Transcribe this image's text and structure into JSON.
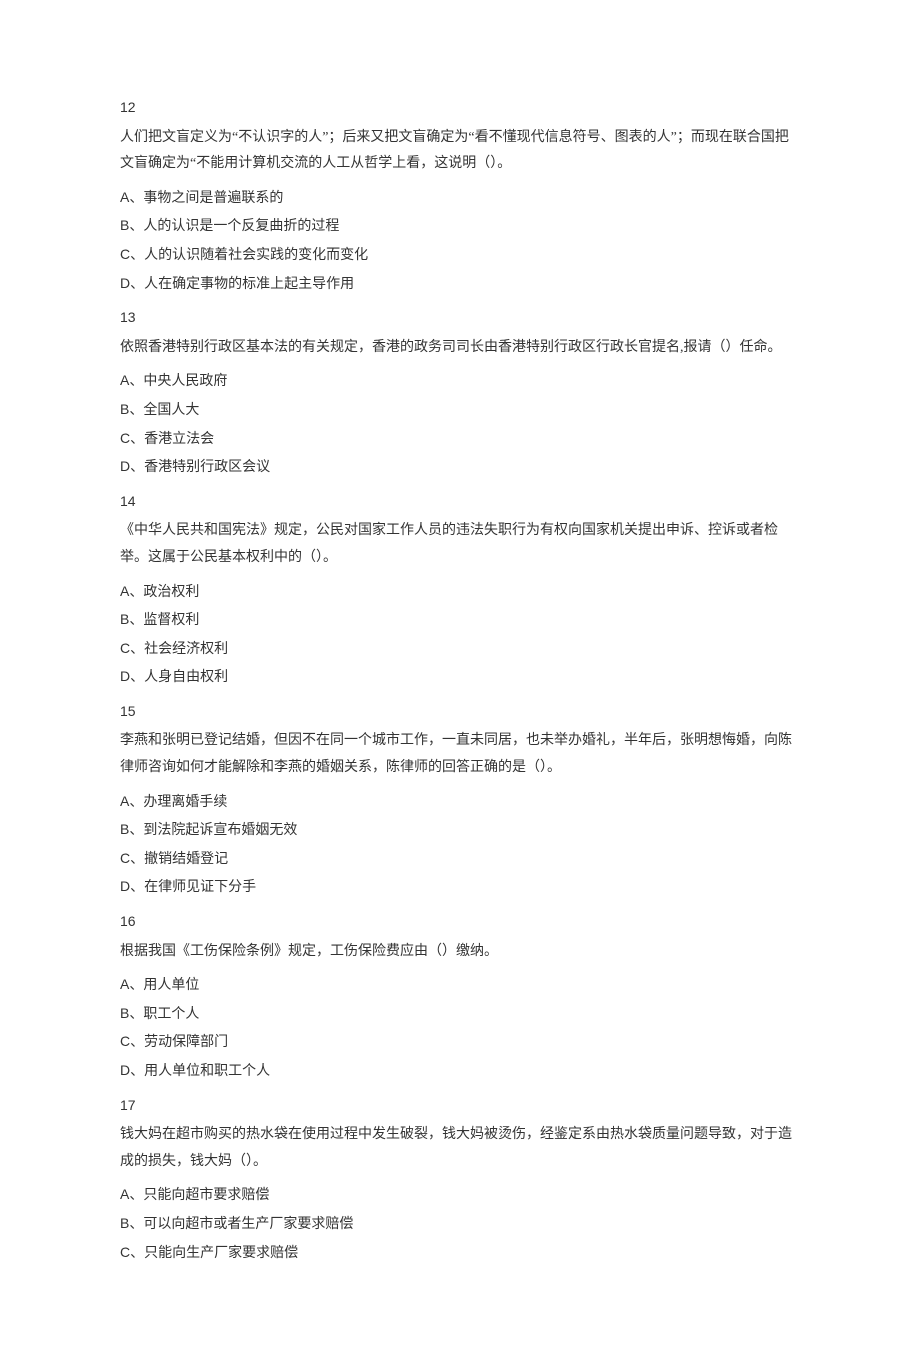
{
  "questions": [
    {
      "num": "12",
      "stem": "人们把文盲定义为“不认识字的人”；后来又把文盲确定为“看不懂现代信息符号、图表的人”；而现在联合国把文盲确定为“不能用计算机交流的人工从哲学上看，这说明（）。",
      "options": [
        {
          "letter": "A、",
          "text": "事物之间是普遍联系的"
        },
        {
          "letter": "B、",
          "text": "人的认识是一个反复曲折的过程"
        },
        {
          "letter": "C、",
          "text": "人的认识随着社会实践的变化而变化"
        },
        {
          "letter": "D、",
          "text": "人在确定事物的标准上起主导作用"
        }
      ]
    },
    {
      "num": "13",
      "stem": "依照香港特别行政区基本法的有关规定，香港的政务司司长由香港特别行政区行政长官提名,报请（）任命。",
      "options": [
        {
          "letter": "A、",
          "text": "中央人民政府"
        },
        {
          "letter": "B、",
          "text": "全国人大"
        },
        {
          "letter": "C、",
          "text": "香港立法会"
        },
        {
          "letter": "D、",
          "text": "香港特别行政区会议"
        }
      ]
    },
    {
      "num": "14",
      "stem": "《中华人民共和国宪法》规定，公民对国家工作人员的违法失职行为有权向国家机关提出申诉、控诉或者检举。这属于公民基本权利中的（）。",
      "options": [
        {
          "letter": "A、",
          "text": "政治权利"
        },
        {
          "letter": "B、",
          "text": "监督权利"
        },
        {
          "letter": "C、",
          "text": "社会经济权利"
        },
        {
          "letter": "D、",
          "text": "人身自由权利"
        }
      ]
    },
    {
      "num": "15",
      "stem": "李燕和张明已登记结婚，但因不在同一个城市工作，一直未同居，也未举办婚礼，半年后，张明想悔婚，向陈律师咨询如何才能解除和李燕的婚姻关系，陈律师的回答正确的是（）。",
      "options": [
        {
          "letter": "A、",
          "text": "办理离婚手续"
        },
        {
          "letter": "B、",
          "text": "到法院起诉宣布婚姻无效"
        },
        {
          "letter": "C、",
          "text": "撤销结婚登记"
        },
        {
          "letter": "D、",
          "text": "在律师见证下分手"
        }
      ]
    },
    {
      "num": "16",
      "stem": "根据我国《工伤保险条例》规定，工伤保险费应由（）缴纳。",
      "options": [
        {
          "letter": "A、",
          "text": "用人单位"
        },
        {
          "letter": "B、",
          "text": "职工个人"
        },
        {
          "letter": "C、",
          "text": "劳动保障部门"
        },
        {
          "letter": "D、",
          "text": "用人单位和职工个人"
        }
      ]
    },
    {
      "num": "17",
      "stem": "钱大妈在超市购买的热水袋在使用过程中发生破裂，钱大妈被烫伤，经鉴定系由热水袋质量问题导致，对于造成的损失，钱大妈（）。",
      "options": [
        {
          "letter": "A、",
          "text": "只能向超市要求赔偿"
        },
        {
          "letter": "B、",
          "text": "可以向超市或者生产厂家要求赔偿"
        },
        {
          "letter": "C、",
          "text": "只能向生产厂家要求赔偿"
        }
      ]
    }
  ]
}
